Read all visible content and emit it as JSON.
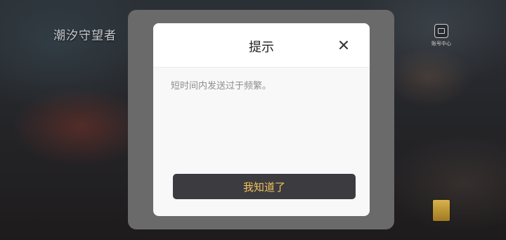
{
  "game": {
    "logo_text": "潮汐守望者",
    "account_center_label": "账号中心"
  },
  "dialog": {
    "title": "提示",
    "message": "短时间内发送过于频繁。",
    "confirm_label": "我知道了"
  },
  "colors": {
    "overlay_frame": "#6a6a6a",
    "dialog_bg": "#f8f8f8",
    "button_bg": "#3c3b40",
    "button_text": "#f0c25a"
  },
  "icons": [
    "close-icon",
    "account-center-icon"
  ]
}
